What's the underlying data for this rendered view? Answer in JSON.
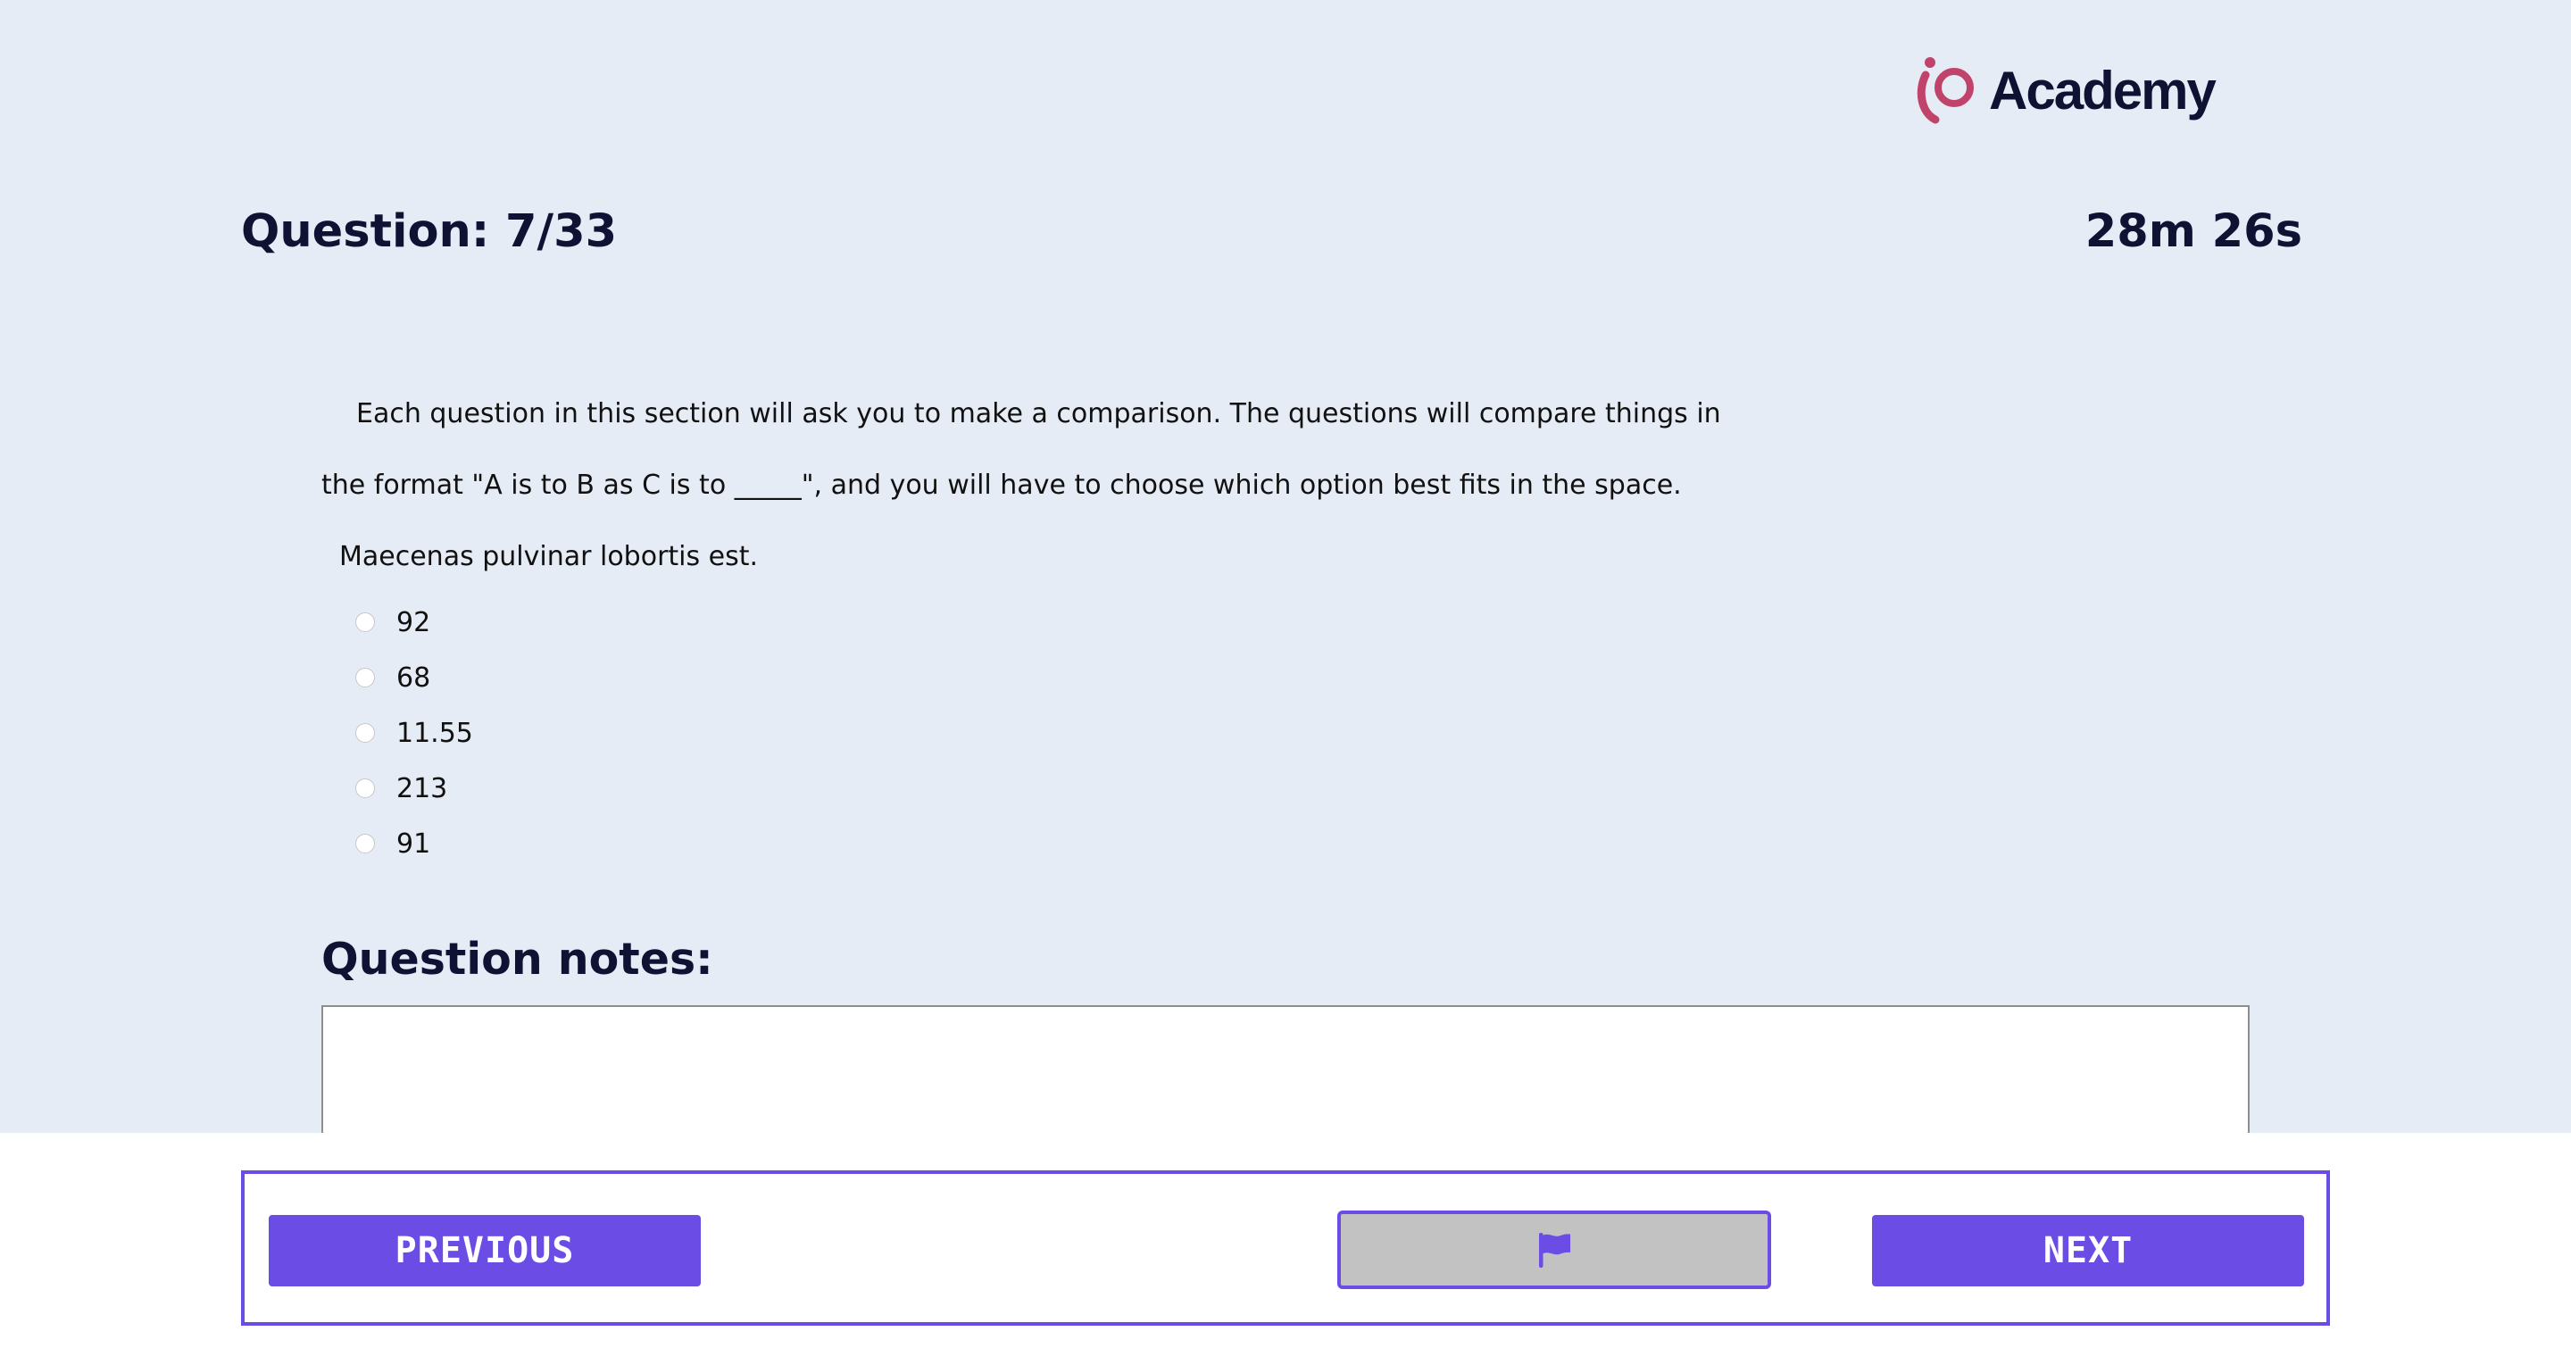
{
  "brand": {
    "name": "Academy",
    "logo_icon": "io-logo-icon",
    "accent_color": "#c0436b"
  },
  "header": {
    "question_counter": "Question: 7/33",
    "timer": "28m 26s"
  },
  "instructions": {
    "line1": "Each question in this section will ask you to make a comparison. The questions will compare things in",
    "line2": "the format \"A is to B as C is to _____\", and you will have to choose which option best fits in the space."
  },
  "question": {
    "prompt": "Maecenas pulvinar lobortis est.",
    "options": [
      "92",
      "68",
      "11.55",
      "213",
      "91"
    ],
    "selected": null
  },
  "notes": {
    "heading": "Question notes:",
    "value": ""
  },
  "footer": {
    "previous_label": "PREVIOUS",
    "flag_icon": "flag-icon",
    "next_label": "NEXT",
    "primary_color": "#6b4de6",
    "flag_button_color": "#c2c2c2"
  }
}
